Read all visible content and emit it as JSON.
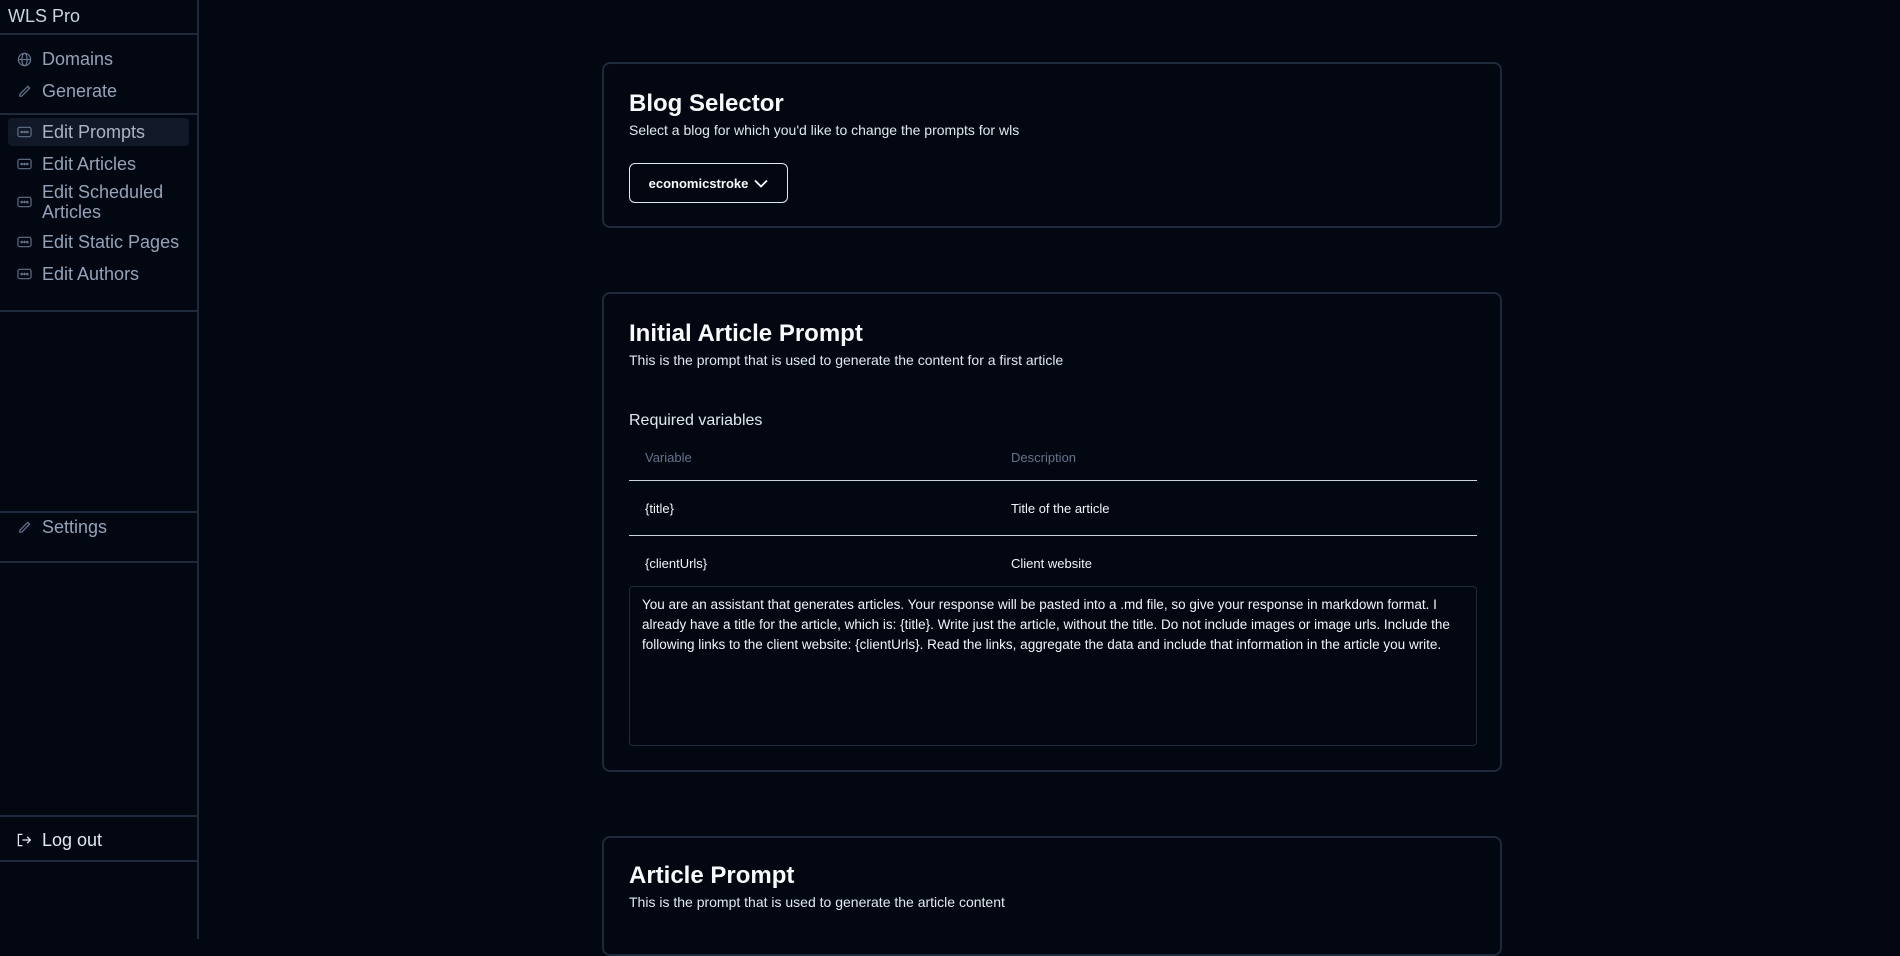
{
  "app": {
    "title": "WLS Pro"
  },
  "sidebar": {
    "top_items": [
      {
        "label": "Domains",
        "icon": "globe-icon"
      },
      {
        "label": "Generate",
        "icon": "pencil-icon"
      }
    ],
    "edit_items": [
      {
        "label": "Edit Prompts",
        "icon": "ellipsis-box-icon",
        "active": true
      },
      {
        "label": "Edit Articles",
        "icon": "ellipsis-box-icon"
      },
      {
        "label": "Edit Scheduled Articles",
        "icon": "ellipsis-box-icon"
      },
      {
        "label": "Edit Static Pages",
        "icon": "ellipsis-box-icon"
      },
      {
        "label": "Edit Authors",
        "icon": "ellipsis-box-icon"
      }
    ],
    "settings": {
      "label": "Settings",
      "icon": "pencil-icon"
    },
    "logout": {
      "label": "Log out",
      "icon": "logout-icon"
    }
  },
  "blog_selector": {
    "title": "Blog Selector",
    "description": "Select a blog for which you'd like to change the prompts for wls",
    "selected": "economicstroke"
  },
  "initial_prompt": {
    "title": "Initial Article Prompt",
    "description": "This is the prompt that is used to generate the content for a first article",
    "required_label": "Required variables",
    "columns": [
      "Variable",
      "Description"
    ],
    "rows": [
      [
        "{title}",
        "Title of the article"
      ],
      [
        "{clientUrls}",
        "Client website"
      ]
    ],
    "text": "You are an assistant that generates articles. Your response will be pasted into a .md file, so give your response in markdown format. I already have a title for the article, which is: {title}. Write just the article, without the title. Do not include images or image urls. Include the following links to the client website: {clientUrls}. Read the links, aggregate the data and include that information in the article you write."
  },
  "article_prompt": {
    "title": "Article Prompt",
    "description": "This is the prompt that is used to generate the article content"
  },
  "colors": {
    "background": "#030711",
    "border": "#1e293b",
    "muted": "#94a3b8"
  }
}
